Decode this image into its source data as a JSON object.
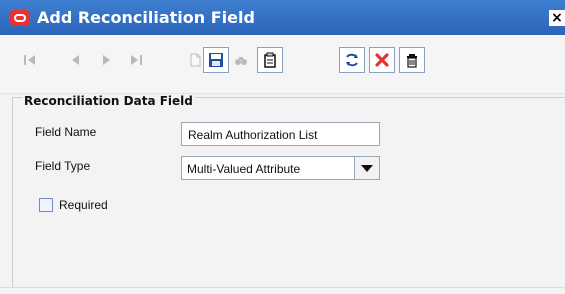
{
  "window": {
    "title": "Add Reconciliation Field",
    "close_label": "×"
  },
  "toolbar": {
    "buttons": [
      {
        "name": "first-record-button",
        "icon": "first-icon",
        "enabled": false
      },
      {
        "name": "previous-record-button",
        "icon": "previous-icon",
        "enabled": false
      },
      {
        "name": "next-record-button",
        "icon": "next-icon",
        "enabled": false
      },
      {
        "name": "last-record-button",
        "icon": "last-icon",
        "enabled": false
      },
      {
        "name": "new-button",
        "icon": "new-document-icon",
        "enabled": false
      },
      {
        "name": "save-button",
        "icon": "save-icon",
        "enabled": true
      },
      {
        "name": "query-button",
        "icon": "binoculars-icon",
        "enabled": false
      },
      {
        "name": "clear-button",
        "icon": "clipboard-icon",
        "enabled": true
      },
      {
        "name": "refresh-button",
        "icon": "refresh-icon",
        "enabled": true
      },
      {
        "name": "cancel-button",
        "icon": "red-x-icon",
        "enabled": true
      },
      {
        "name": "delete-button",
        "icon": "trash-icon",
        "enabled": true
      }
    ]
  },
  "form": {
    "group_title": "Reconciliation Data Field",
    "field_name": {
      "label": "Field Name",
      "value": "Realm Authorization List"
    },
    "field_type": {
      "label": "Field Type",
      "value": "Multi-Valued Attribute"
    },
    "required": {
      "label": "Required",
      "checked": false
    }
  },
  "colors": {
    "title_bar": "#2f6bc3",
    "close_x": "#e83232",
    "save_icon": "#1f4f9b"
  }
}
